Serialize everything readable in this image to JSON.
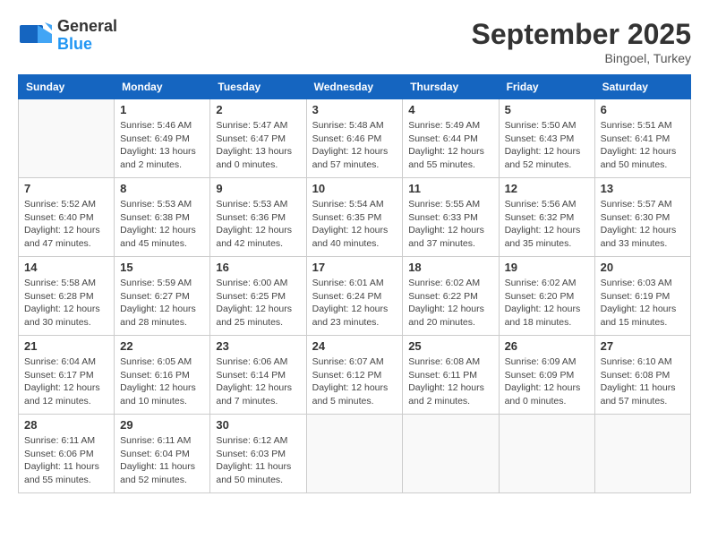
{
  "logo": {
    "general": "General",
    "blue": "Blue"
  },
  "title": "September 2025",
  "location": "Bingoel, Turkey",
  "days_of_week": [
    "Sunday",
    "Monday",
    "Tuesday",
    "Wednesday",
    "Thursday",
    "Friday",
    "Saturday"
  ],
  "weeks": [
    [
      {
        "day": "",
        "info": ""
      },
      {
        "day": "1",
        "info": "Sunrise: 5:46 AM\nSunset: 6:49 PM\nDaylight: 13 hours\nand 2 minutes."
      },
      {
        "day": "2",
        "info": "Sunrise: 5:47 AM\nSunset: 6:47 PM\nDaylight: 13 hours\nand 0 minutes."
      },
      {
        "day": "3",
        "info": "Sunrise: 5:48 AM\nSunset: 6:46 PM\nDaylight: 12 hours\nand 57 minutes."
      },
      {
        "day": "4",
        "info": "Sunrise: 5:49 AM\nSunset: 6:44 PM\nDaylight: 12 hours\nand 55 minutes."
      },
      {
        "day": "5",
        "info": "Sunrise: 5:50 AM\nSunset: 6:43 PM\nDaylight: 12 hours\nand 52 minutes."
      },
      {
        "day": "6",
        "info": "Sunrise: 5:51 AM\nSunset: 6:41 PM\nDaylight: 12 hours\nand 50 minutes."
      }
    ],
    [
      {
        "day": "7",
        "info": "Sunrise: 5:52 AM\nSunset: 6:40 PM\nDaylight: 12 hours\nand 47 minutes."
      },
      {
        "day": "8",
        "info": "Sunrise: 5:53 AM\nSunset: 6:38 PM\nDaylight: 12 hours\nand 45 minutes."
      },
      {
        "day": "9",
        "info": "Sunrise: 5:53 AM\nSunset: 6:36 PM\nDaylight: 12 hours\nand 42 minutes."
      },
      {
        "day": "10",
        "info": "Sunrise: 5:54 AM\nSunset: 6:35 PM\nDaylight: 12 hours\nand 40 minutes."
      },
      {
        "day": "11",
        "info": "Sunrise: 5:55 AM\nSunset: 6:33 PM\nDaylight: 12 hours\nand 37 minutes."
      },
      {
        "day": "12",
        "info": "Sunrise: 5:56 AM\nSunset: 6:32 PM\nDaylight: 12 hours\nand 35 minutes."
      },
      {
        "day": "13",
        "info": "Sunrise: 5:57 AM\nSunset: 6:30 PM\nDaylight: 12 hours\nand 33 minutes."
      }
    ],
    [
      {
        "day": "14",
        "info": "Sunrise: 5:58 AM\nSunset: 6:28 PM\nDaylight: 12 hours\nand 30 minutes."
      },
      {
        "day": "15",
        "info": "Sunrise: 5:59 AM\nSunset: 6:27 PM\nDaylight: 12 hours\nand 28 minutes."
      },
      {
        "day": "16",
        "info": "Sunrise: 6:00 AM\nSunset: 6:25 PM\nDaylight: 12 hours\nand 25 minutes."
      },
      {
        "day": "17",
        "info": "Sunrise: 6:01 AM\nSunset: 6:24 PM\nDaylight: 12 hours\nand 23 minutes."
      },
      {
        "day": "18",
        "info": "Sunrise: 6:02 AM\nSunset: 6:22 PM\nDaylight: 12 hours\nand 20 minutes."
      },
      {
        "day": "19",
        "info": "Sunrise: 6:02 AM\nSunset: 6:20 PM\nDaylight: 12 hours\nand 18 minutes."
      },
      {
        "day": "20",
        "info": "Sunrise: 6:03 AM\nSunset: 6:19 PM\nDaylight: 12 hours\nand 15 minutes."
      }
    ],
    [
      {
        "day": "21",
        "info": "Sunrise: 6:04 AM\nSunset: 6:17 PM\nDaylight: 12 hours\nand 12 minutes."
      },
      {
        "day": "22",
        "info": "Sunrise: 6:05 AM\nSunset: 6:16 PM\nDaylight: 12 hours\nand 10 minutes."
      },
      {
        "day": "23",
        "info": "Sunrise: 6:06 AM\nSunset: 6:14 PM\nDaylight: 12 hours\nand 7 minutes."
      },
      {
        "day": "24",
        "info": "Sunrise: 6:07 AM\nSunset: 6:12 PM\nDaylight: 12 hours\nand 5 minutes."
      },
      {
        "day": "25",
        "info": "Sunrise: 6:08 AM\nSunset: 6:11 PM\nDaylight: 12 hours\nand 2 minutes."
      },
      {
        "day": "26",
        "info": "Sunrise: 6:09 AM\nSunset: 6:09 PM\nDaylight: 12 hours\nand 0 minutes."
      },
      {
        "day": "27",
        "info": "Sunrise: 6:10 AM\nSunset: 6:08 PM\nDaylight: 11 hours\nand 57 minutes."
      }
    ],
    [
      {
        "day": "28",
        "info": "Sunrise: 6:11 AM\nSunset: 6:06 PM\nDaylight: 11 hours\nand 55 minutes."
      },
      {
        "day": "29",
        "info": "Sunrise: 6:11 AM\nSunset: 6:04 PM\nDaylight: 11 hours\nand 52 minutes."
      },
      {
        "day": "30",
        "info": "Sunrise: 6:12 AM\nSunset: 6:03 PM\nDaylight: 11 hours\nand 50 minutes."
      },
      {
        "day": "",
        "info": ""
      },
      {
        "day": "",
        "info": ""
      },
      {
        "day": "",
        "info": ""
      },
      {
        "day": "",
        "info": ""
      }
    ]
  ]
}
